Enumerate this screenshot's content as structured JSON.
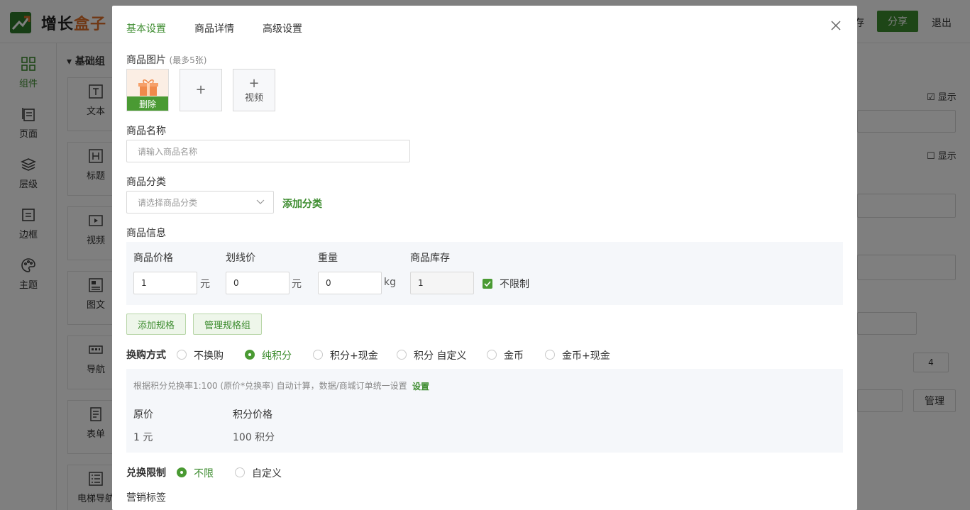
{
  "app": {
    "logo_text_a": "增长",
    "logo_text_b": "盒子",
    "save_label": "存",
    "share_label": "分享",
    "logout_label": "退出",
    "accent": "#3d8c2f"
  },
  "leftnav": [
    {
      "label": "组件",
      "icon": "grid-icon",
      "active": true
    },
    {
      "label": "页面",
      "icon": "pages-icon"
    },
    {
      "label": "层级",
      "icon": "layers-icon"
    },
    {
      "label": "边框",
      "icon": "border-icon"
    },
    {
      "label": "主题",
      "icon": "palette-icon"
    }
  ],
  "panel": {
    "heading": "基础组",
    "widgets": [
      {
        "label": "文本",
        "icon": "text-icon"
      },
      {
        "label": "标题",
        "icon": "heading-icon"
      },
      {
        "label": "视频",
        "icon": "video-icon"
      },
      {
        "label": "图文",
        "icon": "image-text-icon"
      },
      {
        "label": "导航",
        "icon": "nav-icon"
      },
      {
        "label": "表单",
        "icon": "form-icon"
      },
      {
        "label": "电梯导航",
        "icon": "elevator-nav-icon"
      }
    ]
  },
  "rightpanel": {
    "show1": "显示",
    "show2": "显示",
    "count": "4",
    "manage": "管理"
  },
  "modal": {
    "tabs": [
      "基本设置",
      "商品详情",
      "高级设置"
    ],
    "images_label": "商品图片",
    "images_hint": "(最多5张)",
    "delete_label": "删除",
    "add_plus": "+",
    "video_label": "视频",
    "name_label": "商品名称",
    "name_placeholder": "请输入商品名称",
    "category_label": "商品分类",
    "category_placeholder": "请选择商品分类",
    "add_category": "添加分类",
    "info_label": "商品信息",
    "price_label": "商品价格",
    "price_value": "1",
    "price_unit": "元",
    "strike_label": "划线价",
    "strike_value": "0",
    "strike_unit": "元",
    "weight_label": "重量",
    "weight_value": "0",
    "weight_unit": "kg",
    "stock_label": "商品库存",
    "stock_value": "1",
    "unlimited_label": "不限制",
    "add_spec": "添加规格",
    "manage_spec": "管理规格组",
    "exchange_label": "换购方式",
    "exchange_options": [
      "不换购",
      "纯积分",
      "积分+现金",
      "积分 自定义",
      "金币",
      "金币+现金"
    ],
    "exchange_selected": "纯积分",
    "points_note": "根据积分兑换率1:100 (原价*兑换率) 自动计算，数据/商城订单统一设置",
    "points_setting": "设置",
    "orig_price_label": "原价",
    "points_price_label": "积分价格",
    "orig_price_value": "1 元",
    "points_price_value": "100 积分",
    "limit_label": "兑换限制",
    "limit_options": [
      "不限",
      "自定义"
    ],
    "limit_selected": "不限",
    "marketing_label": "营销标签"
  }
}
